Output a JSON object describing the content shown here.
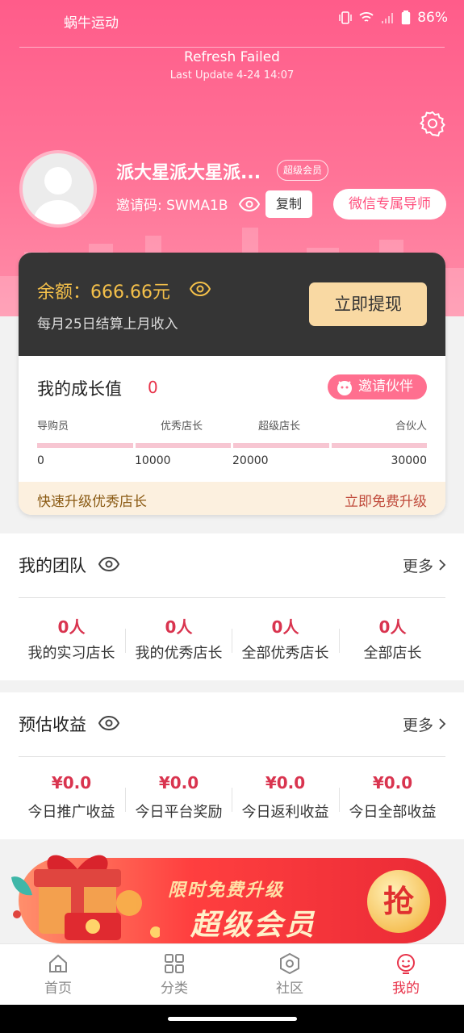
{
  "status_bar": {
    "app_name": "蜗牛运动",
    "battery": "86%"
  },
  "refresh": {
    "title": "Refresh Failed",
    "subtitle": "Last Update 4-24 14:07"
  },
  "profile": {
    "username": "派大星派大星派...",
    "badge": "超级会员",
    "invite_code": "邀请码: SWMA1B",
    "copy_label": "复制",
    "mentor_label": "微信专属导师"
  },
  "balance": {
    "label": "余额：666.66元",
    "subtitle": "每月25日结算上月收入",
    "withdraw_label": "立即提现"
  },
  "growth": {
    "title": "我的成长值",
    "value": "0",
    "invite_label": "邀请伙伴",
    "levels": [
      "导购员",
      "优秀店长",
      "超级店长",
      "合伙人"
    ],
    "thresholds": [
      "0",
      "10000",
      "20000",
      "30000"
    ],
    "upgrade_left": "快速升级优秀店长",
    "upgrade_right": "立即免费升级"
  },
  "team": {
    "title": "我的团队",
    "more": "更多",
    "stats": [
      {
        "value": "0人",
        "label": "我的实习店长"
      },
      {
        "value": "0人",
        "label": "我的优秀店长"
      },
      {
        "value": "0人",
        "label": "全部优秀店长"
      },
      {
        "value": "0人",
        "label": "全部店长"
      }
    ]
  },
  "earnings": {
    "title": "预估收益",
    "more": "更多",
    "stats": [
      {
        "value": "¥0.0",
        "label": "今日推广收益"
      },
      {
        "value": "¥0.0",
        "label": "今日平台奖励"
      },
      {
        "value": "¥0.0",
        "label": "今日返利收益"
      },
      {
        "value": "¥0.0",
        "label": "今日全部收益"
      }
    ]
  },
  "banner": {
    "line1": "限时免费升级",
    "line2": "超级会员",
    "button": "抢"
  },
  "nav": {
    "items": [
      {
        "label": "首页",
        "icon": "home-icon"
      },
      {
        "label": "分类",
        "icon": "grid-icon"
      },
      {
        "label": "社区",
        "icon": "hexagon-icon"
      },
      {
        "label": "我的",
        "icon": "smiley-icon"
      }
    ],
    "active_index": 3
  },
  "colors": {
    "brand_pink": "#ff5c8a",
    "price_red": "#d9344f",
    "gold": "#f4c04a"
  }
}
